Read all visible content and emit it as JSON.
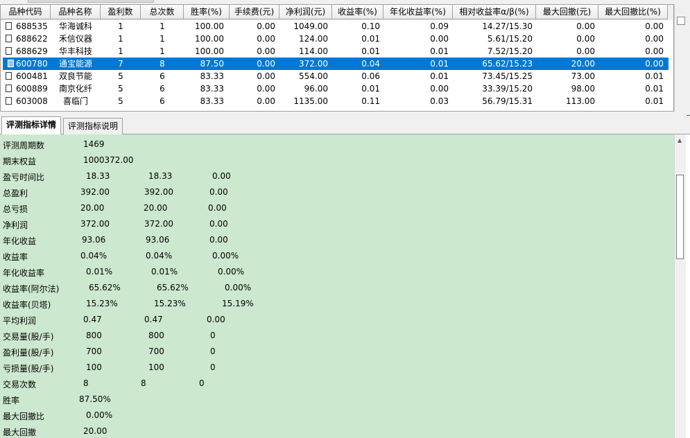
{
  "table": {
    "columns": [
      "品种代码",
      "品种名称",
      "盈利数",
      "总次数",
      "胜率(%)",
      "手续费(元)",
      "净利润(元)",
      "收益率(%)",
      "年化收益率(%)",
      "相对收益率α/β(%)",
      "最大回撤(元)",
      "最大回撤比(%)"
    ],
    "rows": [
      {
        "code": "688535",
        "name": "华海诚科",
        "wins": "1",
        "total": "1",
        "winrate": "100.00",
        "fee": "0.00",
        "profit": "1049.00",
        "ret": "0.10",
        "annual": "0.09",
        "ab": "14.27/15.30",
        "maxdd": "0.00",
        "maxddr": "0.00",
        "selected": false
      },
      {
        "code": "688622",
        "name": "禾信仪器",
        "wins": "1",
        "total": "1",
        "winrate": "100.00",
        "fee": "0.00",
        "profit": "124.00",
        "ret": "0.01",
        "annual": "0.00",
        "ab": "5.61/15.20",
        "maxdd": "0.00",
        "maxddr": "0.00",
        "selected": false
      },
      {
        "code": "688629",
        "name": "华丰科技",
        "wins": "1",
        "total": "1",
        "winrate": "100.00",
        "fee": "0.00",
        "profit": "114.00",
        "ret": "0.01",
        "annual": "0.01",
        "ab": "7.52/15.20",
        "maxdd": "0.00",
        "maxddr": "0.00",
        "selected": false
      },
      {
        "code": "600780",
        "name": "通宝能源",
        "wins": "7",
        "total": "8",
        "winrate": "87.50",
        "fee": "0.00",
        "profit": "372.00",
        "ret": "0.04",
        "annual": "0.01",
        "ab": "65.62/15.23",
        "maxdd": "20.00",
        "maxddr": "0.00",
        "selected": true
      },
      {
        "code": "600481",
        "name": "双良节能",
        "wins": "5",
        "total": "6",
        "winrate": "83.33",
        "fee": "0.00",
        "profit": "554.00",
        "ret": "0.06",
        "annual": "0.01",
        "ab": "73.45/15.25",
        "maxdd": "73.00",
        "maxddr": "0.01",
        "selected": false
      },
      {
        "code": "600889",
        "name": "南京化纤",
        "wins": "5",
        "total": "6",
        "winrate": "83.33",
        "fee": "0.00",
        "profit": "96.00",
        "ret": "0.01",
        "annual": "0.00",
        "ab": "33.39/15.20",
        "maxdd": "98.00",
        "maxddr": "0.01",
        "selected": false
      },
      {
        "code": "603008",
        "name": "喜临门",
        "wins": "5",
        "total": "6",
        "winrate": "83.33",
        "fee": "0.00",
        "profit": "1135.00",
        "ret": "0.11",
        "annual": "0.03",
        "ab": "56.79/15.31",
        "maxdd": "113.00",
        "maxddr": "0.01",
        "selected": false
      }
    ]
  },
  "tabs": [
    "评测指标详情",
    "评测指标说明"
  ],
  "details": [
    {
      "label": "评测周期数",
      "v1": "1469",
      "v2": "",
      "v3": ""
    },
    {
      "label": "期末权益",
      "v1": "1000372.00",
      "v2": "",
      "v3": ""
    },
    {
      "label": "盈亏时间比",
      "v1": "18.33",
      "v2": "18.33",
      "v3": "0.00"
    },
    {
      "label": "总盈利",
      "v1": "392.00",
      "v2": "392.00",
      "v3": "0.00"
    },
    {
      "label": "总亏损",
      "v1": "20.00",
      "v2": "20.00",
      "v3": "0.00"
    },
    {
      "label": "净利润",
      "v1": "372.00",
      "v2": "372.00",
      "v3": "0.00"
    },
    {
      "label": "年化收益",
      "v1": "93.06",
      "v2": "93.06",
      "v3": "0.00"
    },
    {
      "label": "收益率",
      "v1": "0.04%",
      "v2": "0.04%",
      "v3": "0.00%"
    },
    {
      "label": "年化收益率",
      "v1": "0.01%",
      "v2": "0.01%",
      "v3": "0.00%"
    },
    {
      "label": "收益率(阿尔法)",
      "v1": "65.62%",
      "v2": "65.62%",
      "v3": "0.00%"
    },
    {
      "label": "收益率(贝塔)",
      "v1": "15.23%",
      "v2": "15.23%",
      "v3": "15.19%"
    },
    {
      "label": "平均利润",
      "v1": "0.47",
      "v2": "0.47",
      "v3": "0.00"
    },
    {
      "label": "交易量(股/手)",
      "v1": "800",
      "v2": "800",
      "v3": "0"
    },
    {
      "label": "盈利量(股/手)",
      "v1": "700",
      "v2": "700",
      "v3": "0"
    },
    {
      "label": "亏损量(股/手)",
      "v1": "100",
      "v2": "100",
      "v3": "0"
    },
    {
      "label": "交易次数",
      "v1": "8",
      "v2": "8",
      "v3": "0"
    },
    {
      "label": "胜率",
      "v1": "87.50%",
      "v2": "",
      "v3": ""
    },
    {
      "label": "最大回撤比",
      "v1": "0.00%",
      "v2": "",
      "v3": ""
    },
    {
      "label": "最大回撤",
      "v1": "20.00",
      "v2": "",
      "v3": ""
    }
  ],
  "colors": {
    "selection": "#0078d7",
    "detail_bg": "#cce8cf"
  }
}
